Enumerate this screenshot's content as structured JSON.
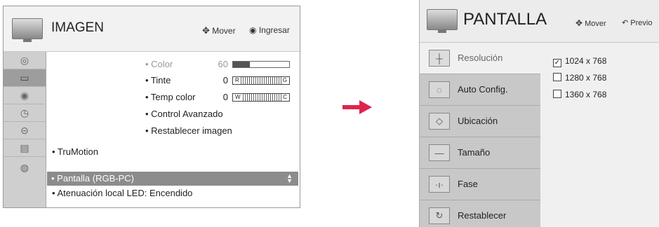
{
  "left_panel": {
    "title": "IMAGEN",
    "hint_move": "Mover",
    "hint_enter": "Ingresar",
    "sub_items": [
      {
        "label": "• Color",
        "value": "60",
        "control": "bar",
        "level": 0.3,
        "dim": true
      },
      {
        "label": "• Tinte",
        "value": "0",
        "control": "scale",
        "ends": [
          "R",
          "G"
        ]
      },
      {
        "label": "• Temp color",
        "value": "0",
        "control": "scale",
        "ends": [
          "W",
          "C"
        ]
      },
      {
        "label": "• Control Avanzado"
      },
      {
        "label": "• Restablecer imagen"
      }
    ],
    "main_items": [
      {
        "label": "• TruMotion"
      },
      {
        "label": "• Pantalla (RGB-PC)",
        "selected": true
      },
      {
        "label": "• Atenuación local LED: Encendido"
      }
    ],
    "rail_icons": [
      "disc-icon",
      "monitor-icon",
      "speaker-icon",
      "clock-icon",
      "lock-icon",
      "briefcase-icon",
      "globe-icon"
    ]
  },
  "right_panel": {
    "title": "PANTALLA",
    "hint_move": "Mover",
    "hint_prev": "Previo",
    "menu": [
      {
        "label": "Resolución",
        "icon": "crosshair-icon",
        "selected": true
      },
      {
        "label": "Auto Config.",
        "icon": "auto-config-icon"
      },
      {
        "label": "Ubicación",
        "icon": "position-icon"
      },
      {
        "label": "Tamaño",
        "icon": "size-icon"
      },
      {
        "label": "Fase",
        "icon": "phase-icon"
      },
      {
        "label": "Restablecer",
        "icon": "reset-icon"
      }
    ],
    "options": [
      {
        "label": "1024 x 768",
        "checked": true
      },
      {
        "label": "1280 x 768",
        "checked": false
      },
      {
        "label": "1360 x 768",
        "checked": false
      }
    ]
  },
  "colors": {
    "highlight": "#8c8c8c",
    "arrow": "#e0244c",
    "rail": "#cfcfcf"
  }
}
